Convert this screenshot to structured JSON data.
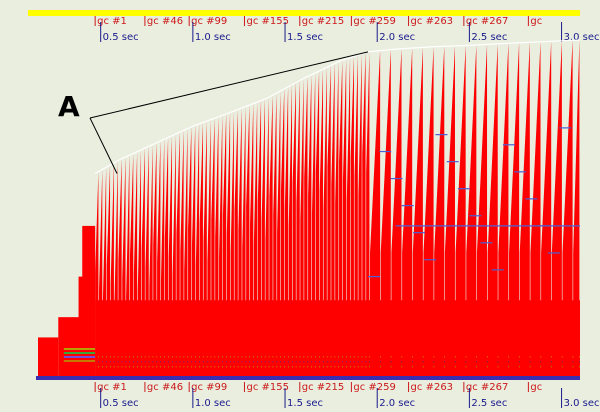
{
  "chart_data": {
    "type": "area",
    "title": "",
    "xlabel": "",
    "ylabel": "",
    "x_unit": "sec",
    "xlim": [
      0.16,
      3.1
    ],
    "ylim": [
      0,
      100
    ],
    "grid": false,
    "colors": {
      "background": "#e9eedf",
      "fill": "#ff0000",
      "envelope": "#ffffff",
      "timeline_bar": "#ffff00",
      "tick_text": "#1a1a8c",
      "gc_text": "#cc1a1a",
      "blue_marks": "#4a5fd8"
    },
    "time_ticks": [
      {
        "x": 0.5,
        "label": "0.5 sec"
      },
      {
        "x": 1.0,
        "label": "1.0 sec"
      },
      {
        "x": 1.5,
        "label": "1.5 sec"
      },
      {
        "x": 2.0,
        "label": "2.0 sec"
      },
      {
        "x": 2.5,
        "label": "2.5 sec"
      },
      {
        "x": 3.0,
        "label": "3.0 sec"
      }
    ],
    "gc_markers": [
      {
        "x": 0.47,
        "label": "gc #1"
      },
      {
        "x": 0.74,
        "label": "gc #46"
      },
      {
        "x": 0.98,
        "label": "gc #99"
      },
      {
        "x": 1.28,
        "label": "gc #155"
      },
      {
        "x": 1.58,
        "label": "gc #215"
      },
      {
        "x": 1.86,
        "label": "gc #259"
      },
      {
        "x": 2.17,
        "label": "gc #263"
      },
      {
        "x": 2.47,
        "label": "gc #267"
      },
      {
        "x": 2.82,
        "label": "gc"
      }
    ],
    "envelope": {
      "x": [
        0.47,
        0.6,
        0.8,
        1.0,
        1.2,
        1.4,
        1.6,
        1.8,
        1.95,
        2.1,
        2.3,
        2.5,
        2.7,
        2.9,
        3.1
      ],
      "y": [
        60.5,
        64.5,
        69.5,
        74.5,
        78.5,
        82.7,
        88.6,
        93.8,
        96.5,
        97.3,
        98.0,
        98.4,
        99.0,
        99.5,
        100
      ]
    },
    "baseline_level": 23,
    "annotation": {
      "label": "A",
      "x_range": [
        0.47,
        1.95
      ]
    }
  }
}
